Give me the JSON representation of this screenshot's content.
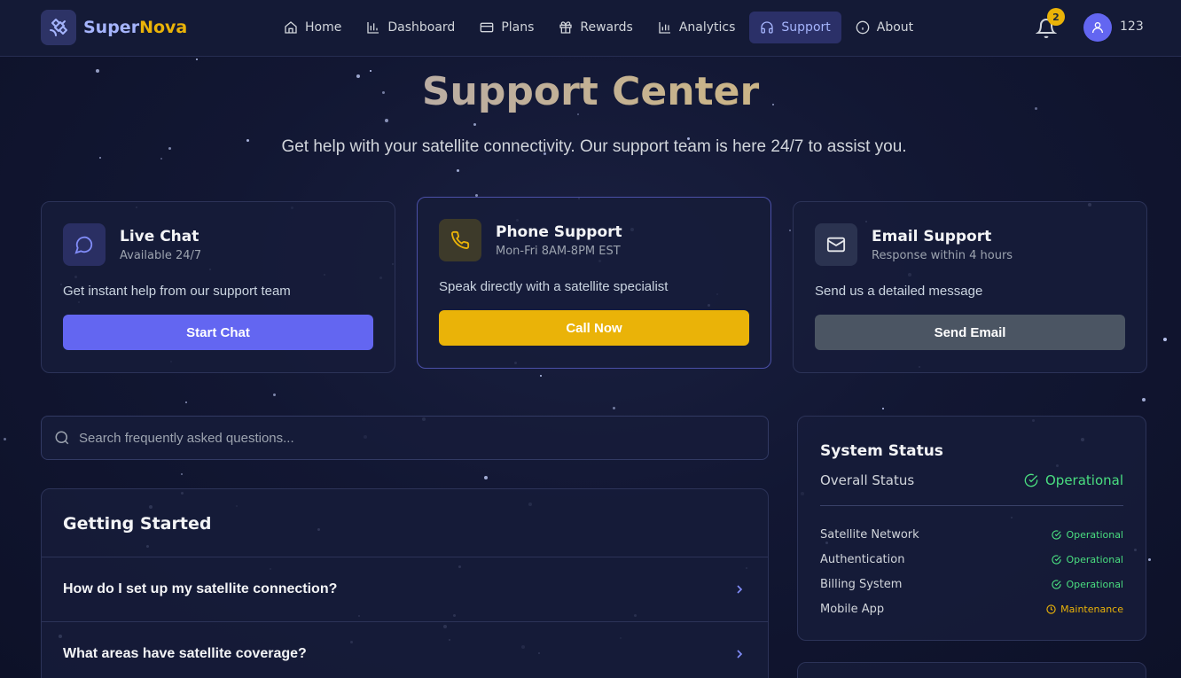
{
  "brand": {
    "part1": "Super",
    "part2": "Nova"
  },
  "nav": {
    "items": [
      {
        "label": "Home",
        "icon": "home-icon"
      },
      {
        "label": "Dashboard",
        "icon": "bar-chart-icon"
      },
      {
        "label": "Plans",
        "icon": "credit-card-icon"
      },
      {
        "label": "Rewards",
        "icon": "gift-icon"
      },
      {
        "label": "Analytics",
        "icon": "chart-icon"
      },
      {
        "label": "Support",
        "icon": "headphones-icon",
        "active": true
      },
      {
        "label": "About",
        "icon": "info-icon"
      }
    ],
    "notifications_count": "2",
    "user_name": "123"
  },
  "hero": {
    "title": "Support Center",
    "subtitle": "Get help with your satellite connectivity. Our support team is here 24/7 to assist you."
  },
  "contact": {
    "chat": {
      "title": "Live Chat",
      "subtitle": "Available 24/7",
      "desc": "Get instant help from our support team",
      "button": "Start Chat"
    },
    "phone": {
      "title": "Phone Support",
      "subtitle": "Mon-Fri 8AM-8PM EST",
      "desc": "Speak directly with a satellite specialist",
      "button": "Call Now"
    },
    "email": {
      "title": "Email Support",
      "subtitle": "Response within 4 hours",
      "desc": "Send us a detailed message",
      "button": "Send Email"
    }
  },
  "search": {
    "placeholder": "Search frequently asked questions..."
  },
  "faq": {
    "section_title": "Getting Started",
    "questions": [
      "How do I set up my satellite connection?",
      "What areas have satellite coverage?"
    ]
  },
  "status": {
    "title": "System Status",
    "overall_label": "Overall Status",
    "overall_value": "Operational",
    "services": [
      {
        "name": "Satellite Network",
        "state": "Operational"
      },
      {
        "name": "Authentication",
        "state": "Operational"
      },
      {
        "name": "Billing System",
        "state": "Operational"
      },
      {
        "name": "Mobile App",
        "state": "Maintenance"
      }
    ]
  },
  "colors": {
    "accent": "#6366f1",
    "gold": "#eab308",
    "ok": "#4ade80",
    "email_button": "#4b5563"
  }
}
